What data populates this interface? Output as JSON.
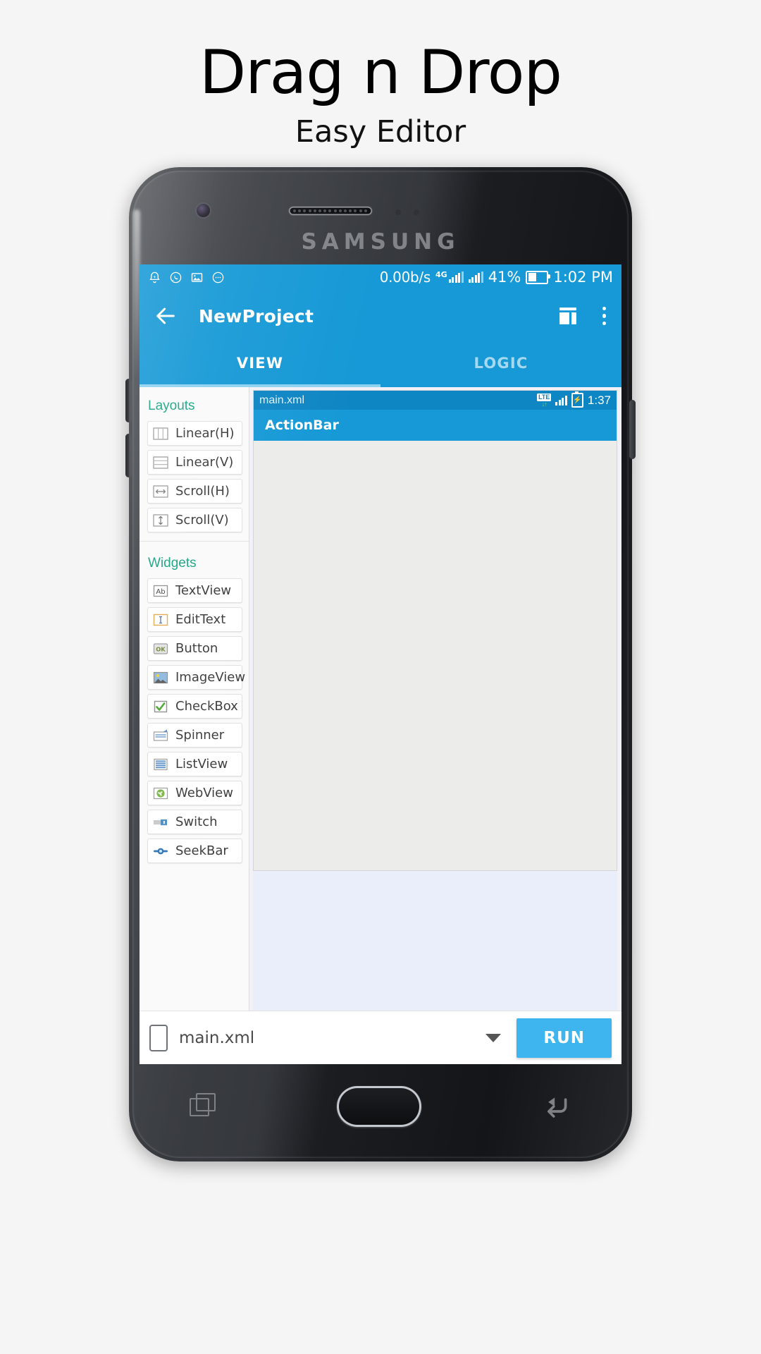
{
  "promo": {
    "title": "Drag n Drop",
    "subtitle": "Easy Editor"
  },
  "device": {
    "brand": "SAMSUNG"
  },
  "status_bar": {
    "notification_icons": [
      "alarm-bell-icon",
      "whatsapp-icon",
      "image-icon",
      "chat-bubble-icon"
    ],
    "net_speed": "0.00b/s",
    "network_type": "4G",
    "battery_percent": "41%",
    "clock": "1:02 PM"
  },
  "toolbar": {
    "back_label": "back-arrow",
    "title": "NewProject",
    "layout_action": "layout-switch",
    "overflow_action": "more-options"
  },
  "tabs": [
    {
      "label": "VIEW",
      "active": true
    },
    {
      "label": "LOGIC",
      "active": false
    }
  ],
  "palette": {
    "sections": [
      {
        "title": "Layouts",
        "items": [
          {
            "label": "Linear(H)",
            "icon": "linear-horizontal-icon"
          },
          {
            "label": "Linear(V)",
            "icon": "linear-vertical-icon"
          },
          {
            "label": "Scroll(H)",
            "icon": "scroll-horizontal-icon"
          },
          {
            "label": "Scroll(V)",
            "icon": "scroll-vertical-icon"
          }
        ]
      },
      {
        "title": "Widgets",
        "items": [
          {
            "label": "TextView",
            "icon": "textview-icon"
          },
          {
            "label": "EditText",
            "icon": "edittext-icon"
          },
          {
            "label": "Button",
            "icon": "button-icon"
          },
          {
            "label": "ImageView",
            "icon": "imageview-icon"
          },
          {
            "label": "CheckBox",
            "icon": "checkbox-icon"
          },
          {
            "label": "Spinner",
            "icon": "spinner-icon"
          },
          {
            "label": "ListView",
            "icon": "listview-icon"
          },
          {
            "label": "WebView",
            "icon": "webview-icon"
          },
          {
            "label": "Switch",
            "icon": "switch-icon"
          },
          {
            "label": "SeekBar",
            "icon": "seekbar-icon"
          }
        ]
      }
    ]
  },
  "canvas": {
    "preview_status": {
      "file": "main.xml",
      "network_type": "LTE",
      "clock": "1:37"
    },
    "action_bar_label": "ActionBar"
  },
  "bottom_bar": {
    "selected_file": "main.xml",
    "run_label": "RUN"
  },
  "nav_bar": {
    "recent_label": "recent-apps",
    "home_label": "home",
    "back_label": "back"
  },
  "colors": {
    "primary": "#1699d6",
    "accent_run": "#3eb5ef",
    "section_title": "#1aa483",
    "tab_indicator": "#8ed2f0"
  }
}
